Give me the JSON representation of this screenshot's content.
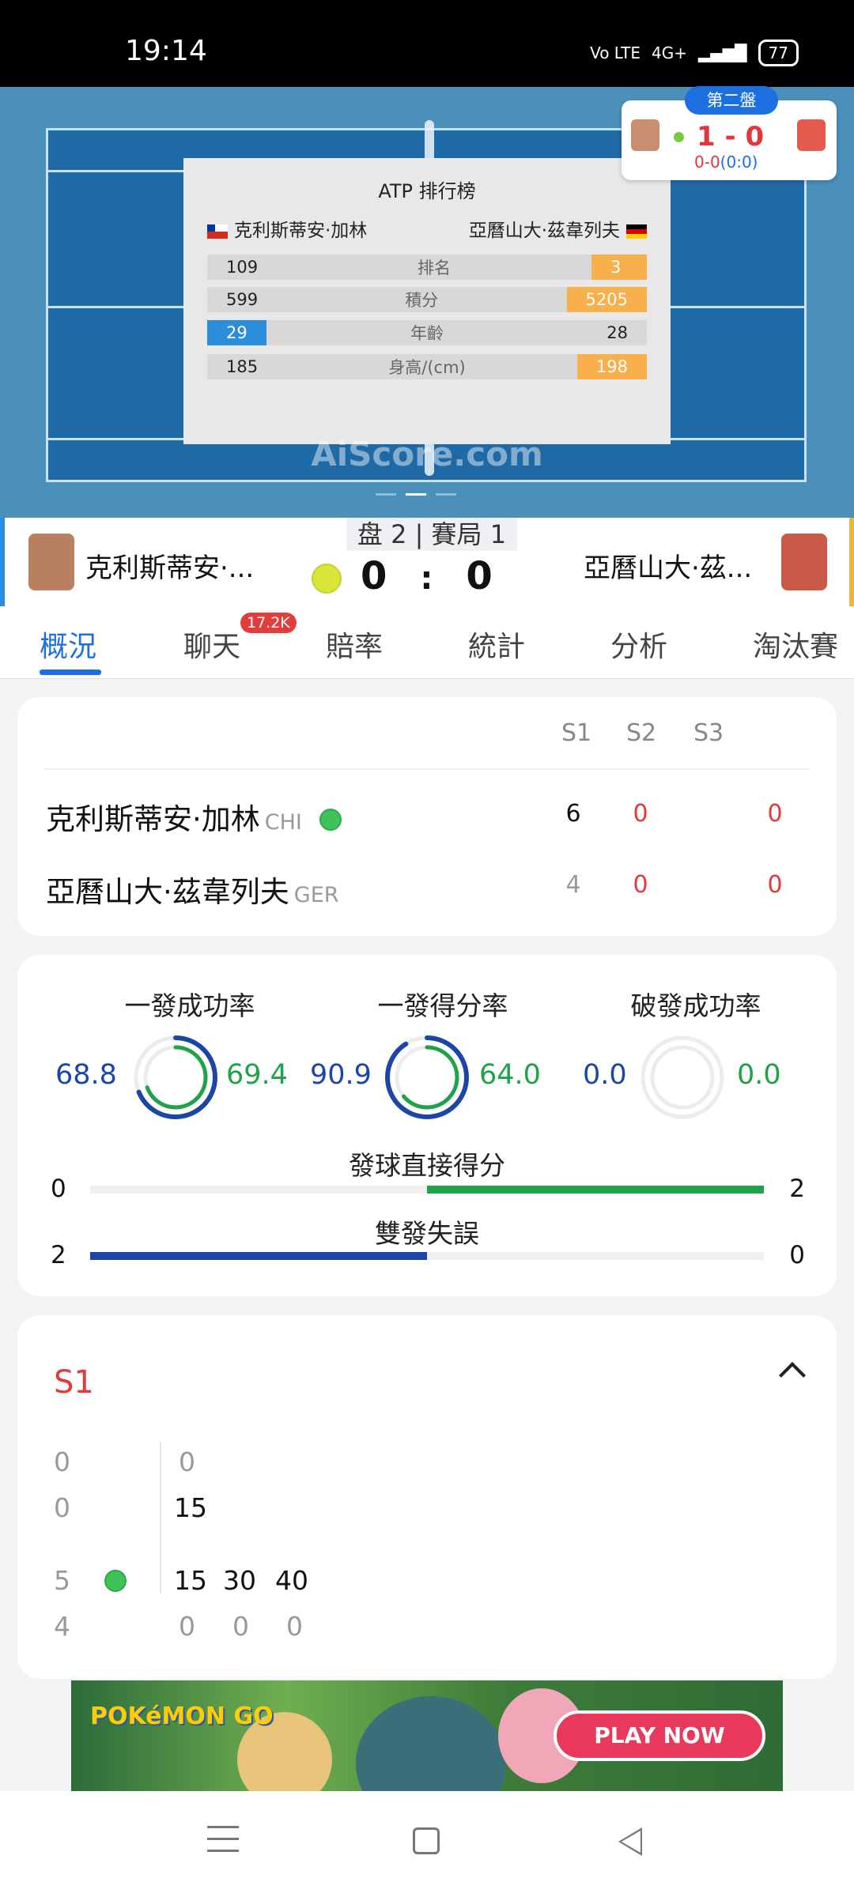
{
  "status": {
    "time": "19:14",
    "network": "4G+",
    "volte": "Vo LTE",
    "battery": "77"
  },
  "overlay": {
    "title": "ATP 排行榜",
    "player1": "克利斯蒂安·加林",
    "player2": "亞曆山大·茲韋列夫",
    "rows": [
      {
        "label": "排名",
        "p1": "109",
        "p2": "3"
      },
      {
        "label": "積分",
        "p1": "599",
        "p2": "5205"
      },
      {
        "label": "年齡",
        "p1": "29",
        "p2": "28"
      },
      {
        "label": "身高/(cm)",
        "p1": "185",
        "p2": "198"
      }
    ],
    "watermark": "AiScore.com"
  },
  "popup": {
    "set_label": "第二盤",
    "score": "1 - 0",
    "game_score": "0-0",
    "tiebreak": "(0:0)"
  },
  "header": {
    "player1": "克利斯蒂安·...",
    "player2": "亞曆山大·茲...",
    "set_game": "盘 2 | 賽局 1",
    "score_p1": "0",
    "score_sep": ":",
    "score_p2": "0"
  },
  "tabs": [
    {
      "label": "概況",
      "active": true
    },
    {
      "label": "聊天",
      "badge": "17.2K"
    },
    {
      "label": "賠率"
    },
    {
      "label": "統計"
    },
    {
      "label": "分析"
    },
    {
      "label": "淘汰賽"
    }
  ],
  "sets": {
    "headers": [
      "S1",
      "S2",
      "S3"
    ],
    "players": [
      {
        "name": "克利斯蒂安·加林",
        "code": "CHI",
        "serving": true,
        "scores": [
          "6",
          "0",
          "0"
        ]
      },
      {
        "name": "亞曆山大·茲韋列夫",
        "code": "GER",
        "serving": false,
        "scores": [
          "4",
          "0",
          "0"
        ]
      }
    ]
  },
  "stats": {
    "rings": [
      {
        "title": "一發成功率",
        "left": "68.8",
        "right": "69.4",
        "left_pct": 68.8,
        "right_pct": 69.4
      },
      {
        "title": "一發得分率",
        "left": "90.9",
        "right": "64.0",
        "left_pct": 90.9,
        "right_pct": 64.0
      },
      {
        "title": "破發成功率",
        "left": "0.0",
        "right": "0.0",
        "left_pct": 0,
        "right_pct": 0
      }
    ],
    "bars": [
      {
        "title": "發球直接得分",
        "left": "0",
        "right": "2"
      },
      {
        "title": "雙發失誤",
        "left": "2",
        "right": "0"
      }
    ]
  },
  "set_detail": {
    "label": "S1",
    "games": [
      {
        "top": [
          "0",
          "0"
        ],
        "bottom": [
          "0",
          "15"
        ]
      },
      {
        "top": [
          "5",
          "15",
          "30",
          "40"
        ],
        "bottom": [
          "4",
          "0",
          "0",
          "0"
        ]
      }
    ]
  },
  "ad": {
    "brand": "POKéMON GO",
    "cta": "PLAY NOW"
  },
  "colors": {
    "blue": "#1b46a8",
    "green": "#1fa24a",
    "red": "#e03a3a",
    "orange": "#f7b04b",
    "accent": "#1b6fe0"
  }
}
